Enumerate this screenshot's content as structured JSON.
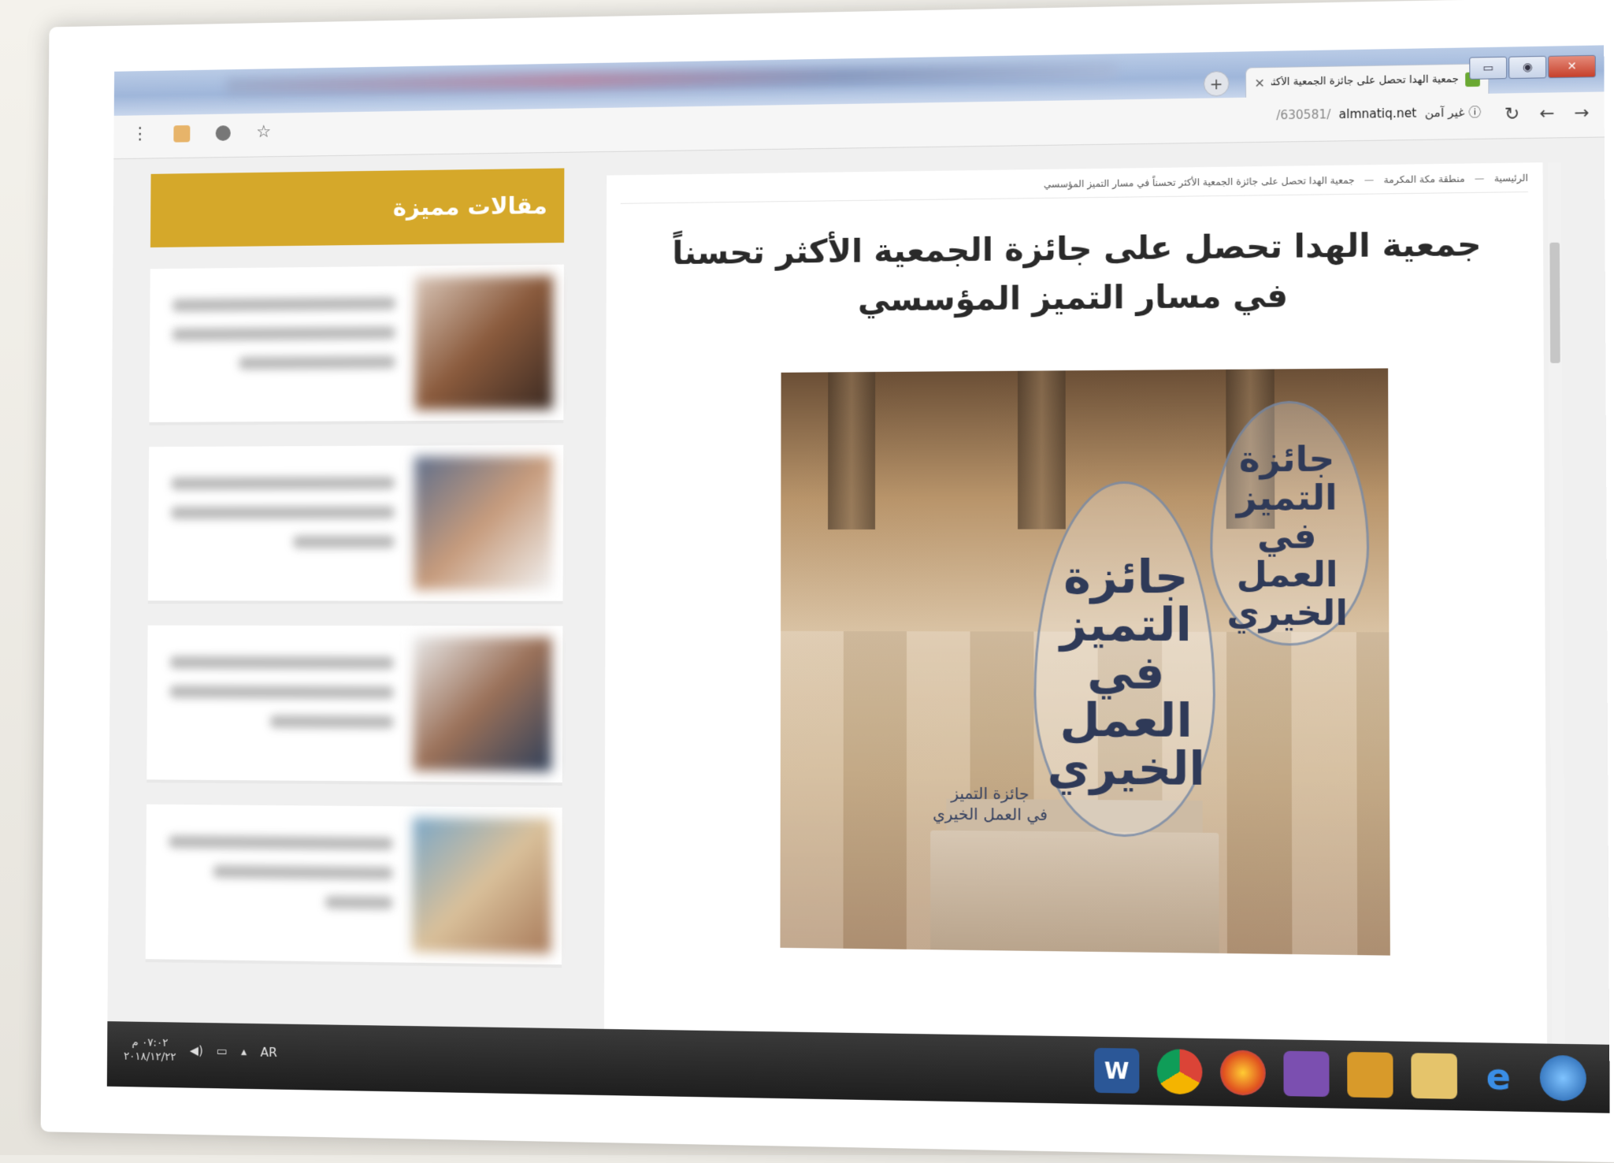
{
  "window": {
    "tab_title": "جمعية الهدا تحصل على جائزة الجمعية الأكثر...",
    "tab_close": "×",
    "new_tab": "+",
    "minimize": "▭",
    "maximize": "◉",
    "close": "✕"
  },
  "addressbar": {
    "back": "→",
    "forward": "←",
    "reload": "↻",
    "site_info": "ⓘ غير آمن",
    "host": "almnatiq.net",
    "path": "/630581/",
    "star": "☆",
    "menu": "⋮"
  },
  "breadcrumb": {
    "home": "الرئيسية",
    "section": "منطقة مكة المكرمة",
    "current": "جمعية الهدا تحصل على جائزة الجمعية الأكثر تحسناً في مسار التميز المؤسسي",
    "separator": "—"
  },
  "article": {
    "headline": "جمعية الهدا تحصل على جائزة الجمعية الأكثر تحسناً في مسار التميز المؤسسي",
    "image_alt_text": {
      "award_name": "جائزة التميز في العمل الخيري",
      "caption_1": "جائزة التميز",
      "caption_2": "في العمل الخيري"
    }
  },
  "sidebar": {
    "title": "مقالات مميزة",
    "cards": [
      {},
      {},
      {},
      {}
    ]
  },
  "taskbar": {
    "apps": [
      "W",
      "chrome",
      "firefox",
      "visual-studio",
      "media-player",
      "file-explorer",
      "e",
      "start"
    ],
    "lang": "AR",
    "time": "٠٧:٠٢ م",
    "date": "٢٠١٨/١٢/٢٢"
  }
}
